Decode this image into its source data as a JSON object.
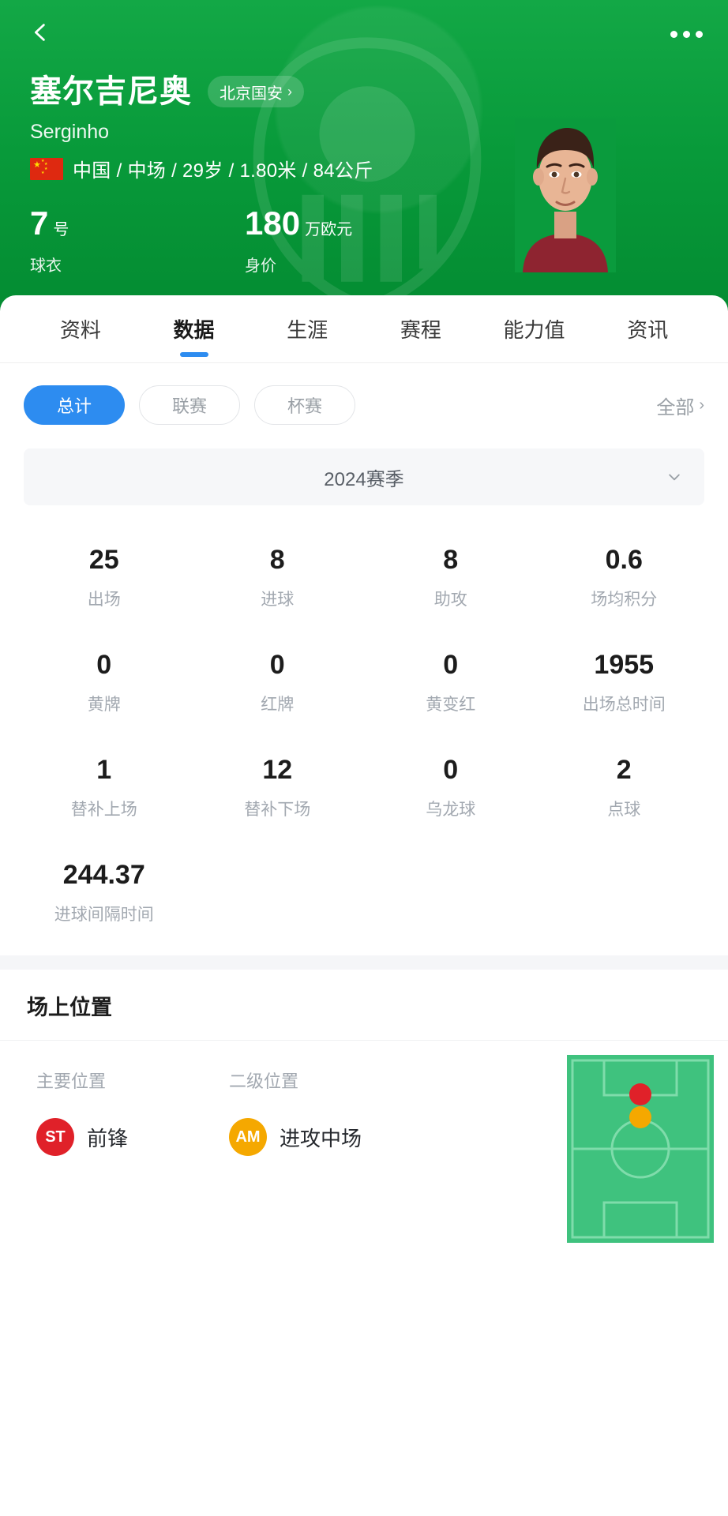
{
  "header": {
    "back_icon": "chevron-left-icon",
    "more_icon": "more-horizontal-icon",
    "player_name_cn": "塞尔吉尼奥",
    "player_name_en": "Serginho",
    "team_chip": "北京国安",
    "team_chip_chevron": "›",
    "flag_alt": "china-flag",
    "meta_line": "中国 / 中场 / 29岁 / 1.80米 / 84公斤",
    "shirt": {
      "value": "7",
      "unit": "号",
      "label": "球衣"
    },
    "market_value": {
      "value": "180",
      "unit": "万欧元",
      "label": "身价"
    }
  },
  "tabs": [
    {
      "label": "资料",
      "active": false
    },
    {
      "label": "数据",
      "active": true
    },
    {
      "label": "生涯",
      "active": false
    },
    {
      "label": "赛程",
      "active": false
    },
    {
      "label": "能力值",
      "active": false
    },
    {
      "label": "资讯",
      "active": false
    }
  ],
  "filters": {
    "chips": [
      {
        "label": "总计",
        "active": true
      },
      {
        "label": "联赛",
        "active": false
      },
      {
        "label": "杯赛",
        "active": false
      }
    ],
    "all_label": "全部",
    "all_chevron": "›"
  },
  "season": {
    "label": "2024赛季",
    "caret_icon": "chevron-down-icon"
  },
  "stats": [
    {
      "value": "25",
      "label": "出场"
    },
    {
      "value": "8",
      "label": "进球"
    },
    {
      "value": "8",
      "label": "助攻"
    },
    {
      "value": "0.6",
      "label": "场均积分"
    },
    {
      "value": "0",
      "label": "黄牌"
    },
    {
      "value": "0",
      "label": "红牌"
    },
    {
      "value": "0",
      "label": "黄变红"
    },
    {
      "value": "1955",
      "label": "出场总时间"
    },
    {
      "value": "1",
      "label": "替补上场"
    },
    {
      "value": "12",
      "label": "替补下场"
    },
    {
      "value": "0",
      "label": "乌龙球"
    },
    {
      "value": "2",
      "label": "点球"
    },
    {
      "value": "244.37",
      "label": "进球间隔时间"
    }
  ],
  "position_section": {
    "title": "场上位置",
    "primary": {
      "head": "主要位置",
      "badge": "ST",
      "badge_color": "#e02129",
      "name": "前锋"
    },
    "secondary": {
      "head": "二级位置",
      "badge": "AM",
      "badge_color": "#f5a800",
      "name": "进攻中场"
    },
    "pitch": {
      "field_color": "#3fc27e",
      "line_color": "#7fdcab",
      "primary_dot_color": "#e02129",
      "secondary_dot_color": "#f5a800",
      "primary_dot_x_pct": 50,
      "primary_dot_y_pct": 21,
      "secondary_dot_x_pct": 50,
      "secondary_dot_y_pct": 33
    }
  },
  "colors": {
    "brand_green": "#089a3a",
    "accent_blue": "#2d8cf0",
    "muted_text": "#a2a8b0"
  }
}
